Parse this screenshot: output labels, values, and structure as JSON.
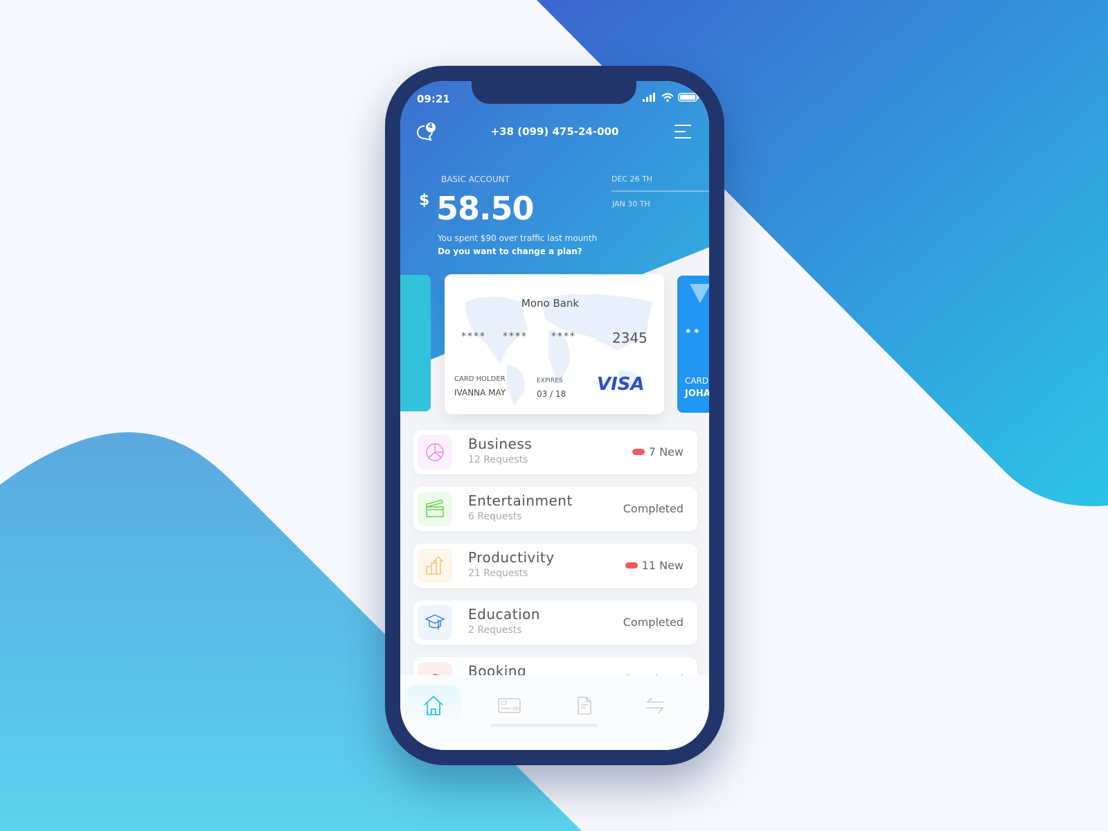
{
  "status_bar": {
    "time": "09:21"
  },
  "header": {
    "notification_count": "4",
    "phone_number": "+38 (099) 475-24-000"
  },
  "account": {
    "label": "BASIC ACCOUNT",
    "currency": "$",
    "balance": "58.50",
    "spent_note": "You spent $90 over traffic last mounth",
    "plan_prompt": "Do you want to change a plan?",
    "date_from": "DEC 26 TH",
    "date_to": "JAN 30 TH"
  },
  "cards": {
    "main": {
      "bank": "Mono Bank",
      "masked_groups": [
        "****",
        "****",
        "****"
      ],
      "last4": "2345",
      "holder_label": "CARD HOLDER",
      "holder_name": "IVANNA MAY",
      "expires_label": "EXPIRES",
      "expires": "03 / 18",
      "network": "VISA"
    },
    "next": {
      "masked": "* *",
      "holder_label": "CARD",
      "holder_name": "JOHA"
    }
  },
  "categories": [
    {
      "title": "Business",
      "requests": "12 Requests",
      "status": "7 New",
      "is_new": true,
      "color": "#e58ae8",
      "bg": "#fdf0fd"
    },
    {
      "title": "Entertainment",
      "requests": "6 Requests",
      "status": "Completed",
      "is_new": false,
      "color": "#6ccf4e",
      "bg": "#eefaea"
    },
    {
      "title": "Productivity",
      "requests": "21 Requests",
      "status": "11 New",
      "is_new": true,
      "color": "#f5c27a",
      "bg": "#fff6ea"
    },
    {
      "title": "Education",
      "requests": "2 Requests",
      "status": "Completed",
      "is_new": false,
      "color": "#3c7fd6",
      "bg": "#eef4fc"
    },
    {
      "title": "Booking",
      "requests": "",
      "status": "Completed",
      "is_new": false,
      "color": "#e8563f",
      "bg": "#fdf0ec"
    }
  ],
  "tabs": [
    {
      "icon": "home-icon",
      "active": true
    },
    {
      "icon": "card-icon"
    },
    {
      "icon": "document-icon"
    },
    {
      "icon": "transfer-icon"
    }
  ],
  "colors": {
    "accent": "#2fb8e0",
    "phone_frame": "#22356b",
    "new_badge": "#ef5a5a",
    "visa": "#2d4fc4"
  }
}
